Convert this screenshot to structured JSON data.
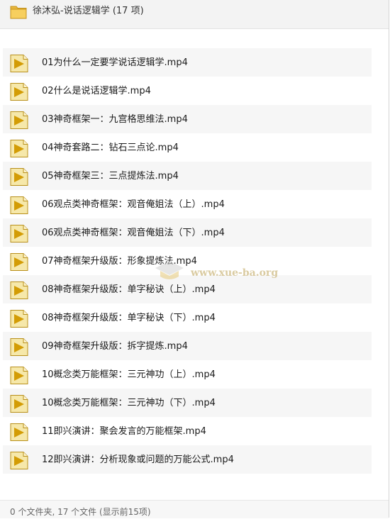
{
  "header": {
    "title": "徐沐弘-说话逻辑学 (17 项)",
    "icon": "folder-icon"
  },
  "files": [
    {
      "name": "01为什么一定要学说话逻辑学.mp4"
    },
    {
      "name": "02什么是说话逻辑学.mp4"
    },
    {
      "name": "03神奇框架一：九宫格思维法.mp4"
    },
    {
      "name": "04神奇套路二：钻石三点论.mp4"
    },
    {
      "name": "05神奇框架三：三点提炼法.mp4"
    },
    {
      "name": "06观点类神奇框架：观音俺姐法（上）.mp4"
    },
    {
      "name": "06观点类神奇框架：观音俺姐法（下）.mp4"
    },
    {
      "name": "07神奇框架升级版：形象提炼法.mp4"
    },
    {
      "name": "08神奇框架升级版：单字秘诀（上）.mp4"
    },
    {
      "name": "08神奇框架升级版：单字秘诀（下）.mp4"
    },
    {
      "name": "09神奇框架升级版：拆字提炼.mp4"
    },
    {
      "name": "10概念类万能框架：三元神功（上）.mp4"
    },
    {
      "name": "10概念类万能框架：三元神功（下）.mp4"
    },
    {
      "name": "11即兴演讲：聚会发言的万能框架.mp4"
    },
    {
      "name": "12即兴演讲：分析现象或问题的万能公式.mp4"
    }
  ],
  "watermark": "www.xue-ba.org",
  "status": "0 个文件夹, 17 个文件 (显示前15项)",
  "colors": {
    "file_icon_body": "#f5e7a6",
    "file_icon_play": "#d9a400",
    "folder": "#f0c24b",
    "row_alt": "#f6f6f6"
  }
}
